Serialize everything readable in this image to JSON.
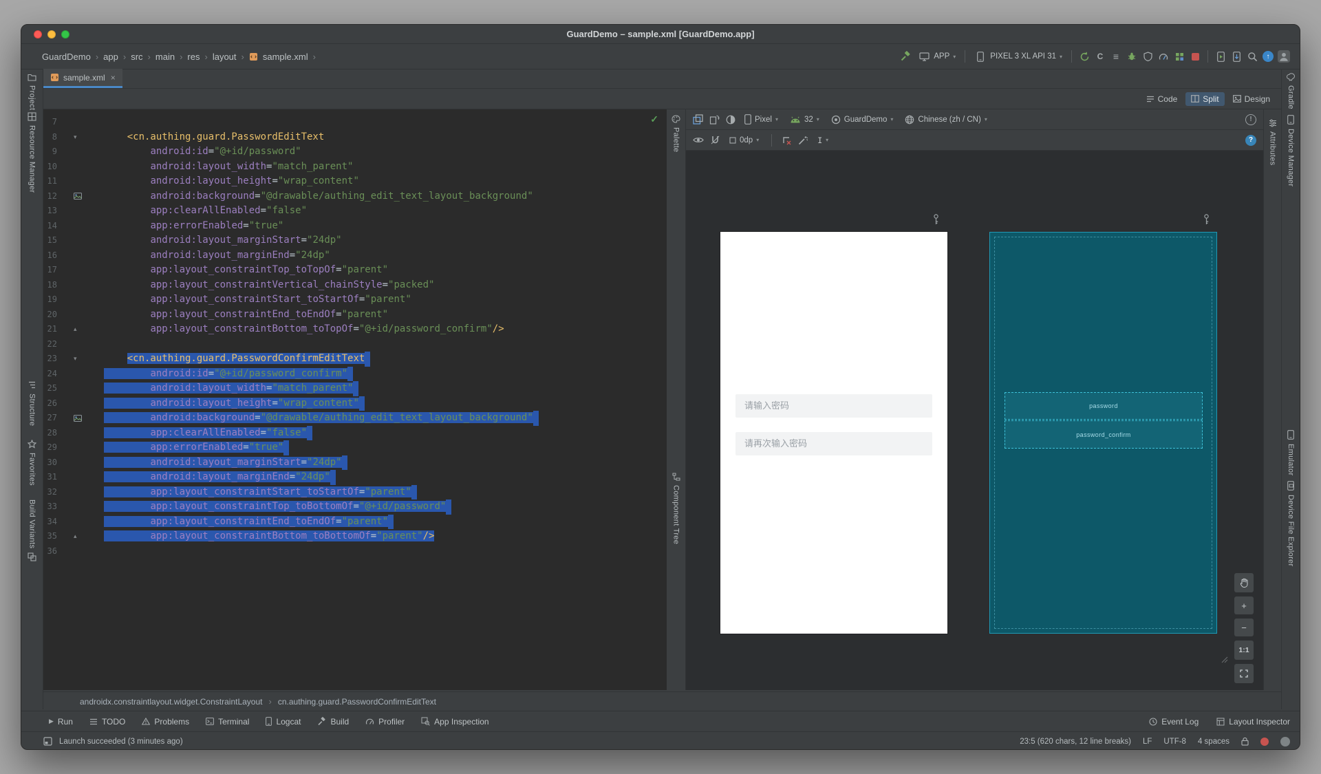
{
  "glyphs": {
    "chevron": "›",
    "dropdown": "▾",
    "close": "×",
    "check": "✓",
    "run": "▶",
    "minus": "−",
    "plus": "+",
    "fold_open": "▾",
    "fold_end": "▴",
    "text_tool": "I",
    "error_badge": "!",
    "help_badge": "?",
    "up_arrow": "↑",
    "c_letter": "C",
    "lines": "≡"
  },
  "colors": {
    "selection": "#2a57ad",
    "xml_tag": "#e8bf6a",
    "xml_attribute": "#9c7fc0",
    "xml_value": "#6a8f57",
    "accent": "#4a88c7",
    "blueprint_bg": "#0d5868",
    "blueprint_line": "#3ec1d8",
    "error_red": "#c75450",
    "ok_green": "#5a9e58"
  },
  "titlebar": {
    "title": "GuardDemo – sample.xml [GuardDemo.app]"
  },
  "toolbar": {
    "breadcrumbs": [
      "GuardDemo",
      "app",
      "src",
      "main",
      "res",
      "layout",
      "sample.xml"
    ],
    "run_config": "APP",
    "device": "PIXEL 3 XL API 31"
  },
  "tab": {
    "label": "sample.xml"
  },
  "view_toggle": {
    "code": "Code",
    "split": "Split",
    "design": "Design"
  },
  "tool_strips": {
    "left_top": [
      "Project",
      "Resource Manager"
    ],
    "left_bottom": [
      "Structure",
      "Favorites",
      "Build Variants"
    ],
    "right_top": [
      "Gradle",
      "Device Manager"
    ],
    "right_bottom": [
      "Emulator",
      "Device File Explorer"
    ],
    "palette": "Palette",
    "component_tree": "Component Tree",
    "attributes": "Attributes"
  },
  "editor": {
    "lines": [
      {
        "n": 7,
        "tokens": []
      },
      {
        "n": 8,
        "icon": "fold",
        "tokens": [
          [
            "tag",
            "    <cn.authing.guard.PasswordEditText"
          ]
        ]
      },
      {
        "n": 9,
        "tokens": [
          [
            "pl",
            "        "
          ],
          [
            "attr",
            "android:id"
          ],
          [
            "eq",
            "="
          ],
          [
            "str",
            "\"@+id/password\""
          ]
        ]
      },
      {
        "n": 10,
        "tokens": [
          [
            "pl",
            "        "
          ],
          [
            "attr",
            "android:layout_width"
          ],
          [
            "eq",
            "="
          ],
          [
            "str",
            "\"match_parent\""
          ]
        ]
      },
      {
        "n": 11,
        "tokens": [
          [
            "pl",
            "        "
          ],
          [
            "attr",
            "android:layout_height"
          ],
          [
            "eq",
            "="
          ],
          [
            "str",
            "\"wrap_content\""
          ]
        ]
      },
      {
        "n": 12,
        "icon": "image",
        "tokens": [
          [
            "pl",
            "        "
          ],
          [
            "attr",
            "android:background"
          ],
          [
            "eq",
            "="
          ],
          [
            "str",
            "\"@drawable/authing_edit_text_layout_background\""
          ]
        ]
      },
      {
        "n": 13,
        "tokens": [
          [
            "pl",
            "        "
          ],
          [
            "attr",
            "app:clearAllEnabled"
          ],
          [
            "eq",
            "="
          ],
          [
            "str",
            "\"false\""
          ]
        ]
      },
      {
        "n": 14,
        "tokens": [
          [
            "pl",
            "        "
          ],
          [
            "attr",
            "app:errorEnabled"
          ],
          [
            "eq",
            "="
          ],
          [
            "str",
            "\"true\""
          ]
        ]
      },
      {
        "n": 15,
        "tokens": [
          [
            "pl",
            "        "
          ],
          [
            "attr",
            "android:layout_marginStart"
          ],
          [
            "eq",
            "="
          ],
          [
            "str",
            "\"24dp\""
          ]
        ]
      },
      {
        "n": 16,
        "tokens": [
          [
            "pl",
            "        "
          ],
          [
            "attr",
            "android:layout_marginEnd"
          ],
          [
            "eq",
            "="
          ],
          [
            "str",
            "\"24dp\""
          ]
        ]
      },
      {
        "n": 17,
        "tokens": [
          [
            "pl",
            "        "
          ],
          [
            "attr",
            "app:layout_constraintTop_toTopOf"
          ],
          [
            "eq",
            "="
          ],
          [
            "str",
            "\"parent\""
          ]
        ]
      },
      {
        "n": 18,
        "tokens": [
          [
            "pl",
            "        "
          ],
          [
            "attr",
            "app:layout_constraintVertical_chainStyle"
          ],
          [
            "eq",
            "="
          ],
          [
            "str",
            "\"packed\""
          ]
        ]
      },
      {
        "n": 19,
        "tokens": [
          [
            "pl",
            "        "
          ],
          [
            "attr",
            "app:layout_constraintStart_toStartOf"
          ],
          [
            "eq",
            "="
          ],
          [
            "str",
            "\"parent\""
          ]
        ]
      },
      {
        "n": 20,
        "tokens": [
          [
            "pl",
            "        "
          ],
          [
            "attr",
            "app:layout_constraintEnd_toEndOf"
          ],
          [
            "eq",
            "="
          ],
          [
            "str",
            "\"parent\""
          ]
        ]
      },
      {
        "n": 21,
        "icon": "foldend",
        "tokens": [
          [
            "pl",
            "        "
          ],
          [
            "attr",
            "app:layout_constraintBottom_toTopOf"
          ],
          [
            "eq",
            "="
          ],
          [
            "str",
            "\"@+id/password_confirm\""
          ],
          [
            "tag",
            "/>"
          ]
        ]
      },
      {
        "n": 22,
        "tokens": []
      },
      {
        "n": 23,
        "icon": "fold",
        "selFrom": 1,
        "tail": true,
        "tokens": [
          [
            "pl",
            "    "
          ],
          [
            "tag",
            "<cn.authing.guard.PasswordConfirmEditText"
          ]
        ]
      },
      {
        "n": 24,
        "sel": true,
        "tail": true,
        "tokens": [
          [
            "pl",
            "        "
          ],
          [
            "attr",
            "android:id"
          ],
          [
            "eq",
            "="
          ],
          [
            "str",
            "\"@+id/password_confirm\""
          ]
        ]
      },
      {
        "n": 25,
        "sel": true,
        "tail": true,
        "tokens": [
          [
            "pl",
            "        "
          ],
          [
            "attr",
            "android:layout_width"
          ],
          [
            "eq",
            "="
          ],
          [
            "str",
            "\"match_parent\""
          ]
        ]
      },
      {
        "n": 26,
        "sel": true,
        "tail": true,
        "tokens": [
          [
            "pl",
            "        "
          ],
          [
            "attr",
            "android:layout_height"
          ],
          [
            "eq",
            "="
          ],
          [
            "str",
            "\"wrap_content\""
          ]
        ]
      },
      {
        "n": 27,
        "icon": "image",
        "sel": true,
        "tail": true,
        "tokens": [
          [
            "pl",
            "        "
          ],
          [
            "attr",
            "android:background"
          ],
          [
            "eq",
            "="
          ],
          [
            "str",
            "\"@drawable/authing_edit_text_layout_background\""
          ]
        ]
      },
      {
        "n": 28,
        "sel": true,
        "tail": true,
        "tokens": [
          [
            "pl",
            "        "
          ],
          [
            "attr",
            "app:clearAllEnabled"
          ],
          [
            "eq",
            "="
          ],
          [
            "str",
            "\"false\""
          ]
        ]
      },
      {
        "n": 29,
        "sel": true,
        "tail": true,
        "tokens": [
          [
            "pl",
            "        "
          ],
          [
            "attr",
            "app:errorEnabled"
          ],
          [
            "eq",
            "="
          ],
          [
            "str",
            "\"true\""
          ]
        ]
      },
      {
        "n": 30,
        "sel": true,
        "tail": true,
        "tokens": [
          [
            "pl",
            "        "
          ],
          [
            "attr",
            "android:layout_marginStart"
          ],
          [
            "eq",
            "="
          ],
          [
            "str",
            "\"24dp\""
          ]
        ]
      },
      {
        "n": 31,
        "sel": true,
        "tail": true,
        "tokens": [
          [
            "pl",
            "        "
          ],
          [
            "attr",
            "android:layout_marginEnd"
          ],
          [
            "eq",
            "="
          ],
          [
            "str",
            "\"24dp\""
          ]
        ]
      },
      {
        "n": 32,
        "sel": true,
        "tail": true,
        "tokens": [
          [
            "pl",
            "        "
          ],
          [
            "attr",
            "app:layout_constraintStart_toStartOf"
          ],
          [
            "eq",
            "="
          ],
          [
            "str",
            "\"parent\""
          ]
        ]
      },
      {
        "n": 33,
        "sel": true,
        "tail": true,
        "tokens": [
          [
            "pl",
            "        "
          ],
          [
            "attr",
            "app:layout_constraintTop_toBottomOf"
          ],
          [
            "eq",
            "="
          ],
          [
            "str",
            "\"@+id/password\""
          ]
        ]
      },
      {
        "n": 34,
        "sel": true,
        "tail": true,
        "tokens": [
          [
            "pl",
            "        "
          ],
          [
            "attr",
            "app:layout_constraintEnd_toEndOf"
          ],
          [
            "eq",
            "="
          ],
          [
            "str",
            "\"parent\""
          ]
        ]
      },
      {
        "n": 35,
        "icon": "foldend",
        "sel": true,
        "tokens": [
          [
            "pl",
            "        "
          ],
          [
            "attr",
            "app:layout_constraintBottom_toBottomOf"
          ],
          [
            "eq",
            "="
          ],
          [
            "str",
            "\"parent\""
          ],
          [
            "tag",
            "/>"
          ]
        ]
      },
      {
        "n": 36,
        "tokens": []
      }
    ]
  },
  "design": {
    "toolbar": {
      "device": "Pixel",
      "api": "32",
      "theme": "GuardDemo",
      "locale": "Chinese (zh / CN)",
      "margin": "0dp"
    },
    "preview_fields": [
      {
        "hint": "请输入密码"
      },
      {
        "hint": "请再次输入密码"
      }
    ],
    "blueprint_labels": [
      "password",
      "password_confirm"
    ],
    "zoom_fit": "1:1"
  },
  "xml_breadcrumbs": [
    "androidx.constraintlayout.widget.ConstraintLayout",
    "cn.authing.guard.PasswordConfirmEditText"
  ],
  "bottom_bar": {
    "left": [
      "Run",
      "TODO",
      "Problems",
      "Terminal",
      "Logcat",
      "Build",
      "Profiler",
      "App Inspection"
    ],
    "right": [
      "Event Log",
      "Layout Inspector"
    ]
  },
  "status_bar": {
    "message": "Launch succeeded (3 minutes ago)",
    "caret": "23:5 (620 chars, 12 line breaks)",
    "line_sep": "LF",
    "encoding": "UTF-8",
    "indent": "4 spaces"
  }
}
